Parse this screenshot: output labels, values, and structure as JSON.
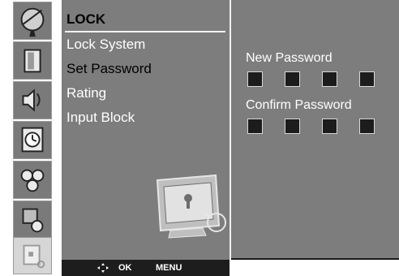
{
  "menu": {
    "title": "LOCK",
    "items": [
      {
        "label": "Lock System"
      },
      {
        "label": "Set Password"
      },
      {
        "label": "Rating"
      },
      {
        "label": "Input Block"
      }
    ]
  },
  "bottom_bar": {
    "ok_label": "OK",
    "menu_label": "MENU"
  },
  "password": {
    "new_label": "New Password",
    "confirm_label": "Confirm Password",
    "digits_per_field": 4
  },
  "colors": {
    "panel_bg": "#7d7d7d",
    "selected_text": "#000000",
    "normal_text": "#ffffff",
    "box_fill": "#1c1c1c"
  }
}
